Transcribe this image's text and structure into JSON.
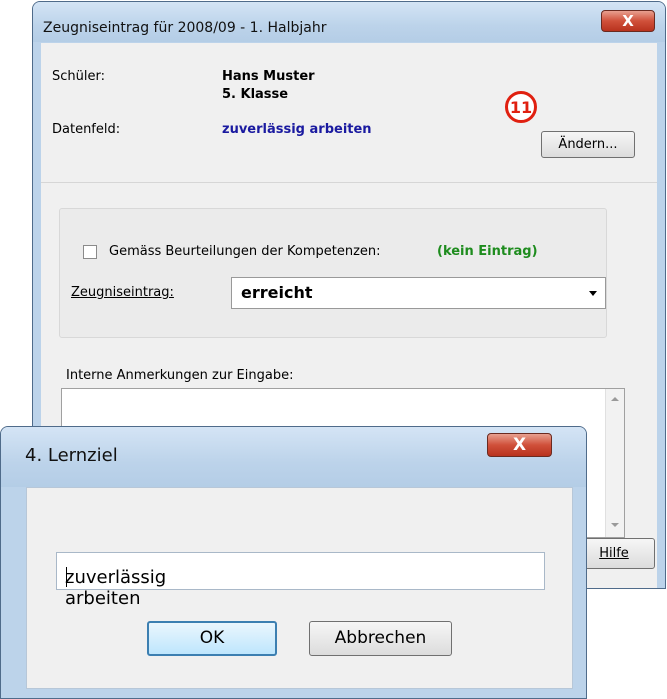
{
  "main_window": {
    "title": "Zeugniseintrag für 2008/09 - 1. Halbjahr",
    "close_label": "X",
    "student_label": "Schüler:",
    "student_name": "Hans Muster",
    "student_class": "5. Klasse",
    "datafield_label": "Datenfeld:",
    "datafield_value": "zuverlässig arbeiten",
    "change_button": "Ändern...",
    "step_badge": "11",
    "checkbox_label": "Gemäss Beurteilungen der Kompetenzen:",
    "checkbox_checked": false,
    "competence_status": "(kein Eintrag)",
    "entry_label": "Zeugniseintrag:",
    "entry_value": "erreicht",
    "notes_label": "Interne Anmerkungen zur Eingabe:",
    "notes_value": "",
    "help_button": "Hilfe"
  },
  "dialog": {
    "title": "4. Lernziel",
    "close_label": "X",
    "input_value": "zuverlässig arbeiten",
    "ok_button": "OK",
    "cancel_button": "Abbrechen"
  },
  "colors": {
    "link_blue": "#1a1aa0",
    "status_green": "#1e8c1e",
    "badge_red": "#e02010"
  }
}
